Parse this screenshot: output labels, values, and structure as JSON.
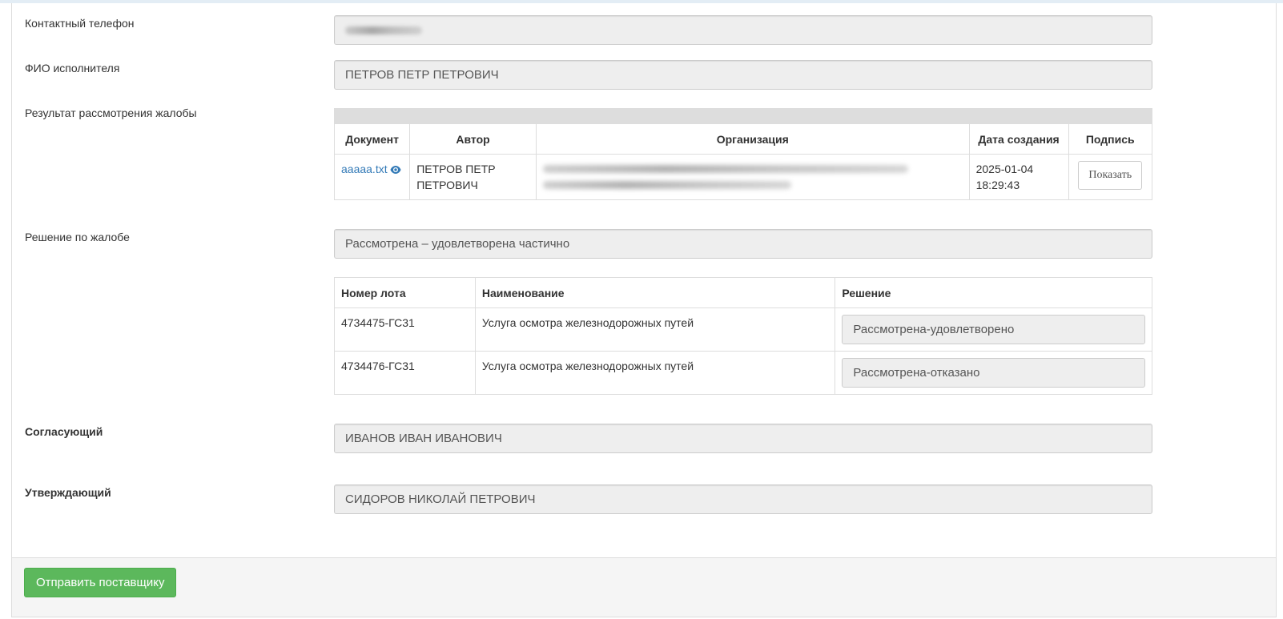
{
  "form": {
    "contact_phone": {
      "label": "Контактный телефон"
    },
    "executor": {
      "label": "ФИО исполнителя",
      "value": "ПЕТРОВ ПЕТР ПЕТРОВИЧ"
    },
    "review_result": {
      "label": "Результат рассмотрения жалобы"
    },
    "decision": {
      "label": "Решение по жалобе",
      "value": "Рассмотрена – удовлетворена частично"
    },
    "approver": {
      "label": "Согласующий",
      "value": "ИВАНОВ ИВАН ИВАНОВИЧ"
    },
    "confirmer": {
      "label": "Утверждающий",
      "value": "СИДОРОВ НИКОЛАЙ ПЕТРОВИЧ"
    }
  },
  "documents": {
    "columns": [
      "Документ",
      "Автор",
      "Организация",
      "Дата создания",
      "Подпись"
    ],
    "rows": [
      {
        "document": "aaaaa.txt",
        "author_line1": "ПЕТРОВ ПЕТР",
        "author_line2": "ПЕТРОВИЧ",
        "date": "2025-01-04",
        "time": "18:29:43",
        "sign_button": "Показать"
      }
    ]
  },
  "lots": {
    "columns": [
      "Номер лота",
      "Наименование",
      "Решение"
    ],
    "rows": [
      {
        "number": "4734475-ГС31",
        "name": "Услуга осмотра железнодорожных путей",
        "decision": "Рассмотрена-удовлетворено"
      },
      {
        "number": "4734476-ГС31",
        "name": "Услуга осмотра железнодорожных путей",
        "decision": "Рассмотрена-отказано"
      }
    ]
  },
  "footer": {
    "send_button": "Отправить поставщику"
  },
  "colors": {
    "link": "#337ab7",
    "success": "#5cb85c",
    "field_bg": "#eeeeee"
  }
}
